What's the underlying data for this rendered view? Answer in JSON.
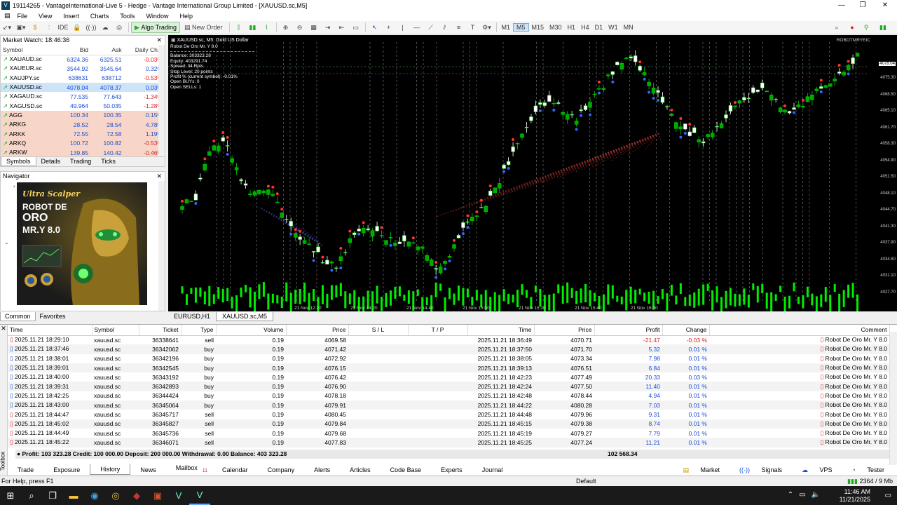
{
  "window": {
    "title": "19114265 - VantageInternational-Live 5 - Hedge - Vantage International Group Limited - [XAUUSD.sc,M5]"
  },
  "menu": [
    "File",
    "View",
    "Insert",
    "Charts",
    "Tools",
    "Window",
    "Help"
  ],
  "toolbar": {
    "algo": "Algo Trading",
    "new_order": "New Order",
    "timeframes": [
      "M1",
      "M5",
      "M15",
      "M30",
      "H1",
      "H4",
      "D1",
      "W1",
      "MN"
    ],
    "active_tf": "M5"
  },
  "market_watch": {
    "title": "Market Watch: 18:46:36",
    "headers": [
      "Symbol",
      "Bid",
      "Ask",
      "Daily Ch..."
    ],
    "rows": [
      [
        "XAUAUD.sc",
        "6324.36",
        "6325.51",
        "-0.03%"
      ],
      [
        "XAUEUR.sc",
        "3544.92",
        "3545.64",
        "0.32%"
      ],
      [
        "XAUJPY.sc",
        "638631",
        "638712",
        "-0.53%"
      ],
      [
        "XAUUSD.sc",
        "4078.04",
        "4078.37",
        "0.03%"
      ],
      [
        "XAGAUD.sc",
        "77.535",
        "77.643",
        "-1.34%"
      ],
      [
        "XAGUSD.sc",
        "49.964",
        "50.035",
        "-1.28%"
      ],
      [
        "AGG",
        "100.34",
        "100.35",
        "0.15%"
      ],
      [
        "ARKG",
        "28.52",
        "28.54",
        "4.78%"
      ],
      [
        "ARKK",
        "72.55",
        "72.58",
        "1.19%"
      ],
      [
        "ARKQ",
        "100.72",
        "100.82",
        "-0.53%"
      ],
      [
        "ARKW",
        "139.85",
        "140.42",
        "-0.46%"
      ]
    ],
    "tabs": [
      "Symbols",
      "Details",
      "Trading",
      "Ticks"
    ]
  },
  "navigator": {
    "title": "Navigator",
    "ad_line1": "Ultra Scalper",
    "ad_line2": "ROBOT DE",
    "ad_line3": "ORO",
    "ad_line4": "MR.Y 8.0",
    "tabs": [
      "Common",
      "Favorites"
    ]
  },
  "chart": {
    "symbol_line": "XAUUSD.sc, M5: Gold US Dollar",
    "ea": "Robot De Oro Mr. Y 8.0",
    "info": [
      "Balance: 303323.28",
      "Equity: 403291.74",
      "Spread: 34 Rpts",
      "Stop Level: 20 points",
      "Profit % (current symbol): -0.01%",
      "Open BUYs: 0",
      "Open SELLs: 1"
    ],
    "corner": "ROBOTMRYEIC",
    "prices": [
      "4075.30",
      "4068.50",
      "4065.10",
      "4061.70",
      "4058.30",
      "4054.90",
      "4051.50",
      "4048.10",
      "4044.70",
      "4041.30",
      "4037.90",
      "4034.50",
      "4031.10",
      "4027.70"
    ],
    "current_price": "4078.04",
    "time_labels": [
      "21 Nov 12:20",
      "21 Nov 14:20",
      "21 Nov 14:40",
      "21 Nov 15:00",
      "21 Nov 15:20",
      "21 Nov 15:40",
      "21 Nov 16:00"
    ],
    "tabs": [
      "EURUSD,H1",
      "XAUUSD.sc,M5"
    ]
  },
  "history": {
    "headers": [
      "Time",
      "Symbol",
      "Ticket",
      "Type",
      "Volume",
      "Price",
      "S / L",
      "T / P",
      "Time",
      "Price",
      "Profit",
      "Change",
      "Comment"
    ],
    "rows": [
      [
        "2025.11.21 18:29:10",
        "xauusd.sc",
        "36338641",
        "sell",
        "0.19",
        "4069.58",
        "",
        "",
        "2025.11.21 18:36:49",
        "4070.71",
        "-21.47",
        "-0.03 %",
        "Robot De Oro Mr. Y 8.0"
      ],
      [
        "2025.11.21 18:37:46",
        "xauusd.sc",
        "36342062",
        "buy",
        "0.19",
        "4071.42",
        "",
        "",
        "2025.11.21 18:37:50",
        "4071.70",
        "5.32",
        "0.01 %",
        "Robot De Oro Mr. Y 8.0"
      ],
      [
        "2025.11.21 18:38:01",
        "xauusd.sc",
        "36342196",
        "buy",
        "0.19",
        "4072.92",
        "",
        "",
        "2025.11.21 18:38:05",
        "4073.34",
        "7.98",
        "0.01 %",
        "Robot De Oro Mr. Y 8.0"
      ],
      [
        "2025.11.21 18:39:01",
        "xauusd.sc",
        "36342545",
        "buy",
        "0.19",
        "4076.15",
        "",
        "",
        "2025.11.21 18:39:13",
        "4076.51",
        "6.84",
        "0.01 %",
        "Robot De Oro Mr. Y 8.0"
      ],
      [
        "2025.11.21 18:40:00",
        "xauusd.sc",
        "36343192",
        "buy",
        "0.19",
        "4076.42",
        "",
        "",
        "2025.11.21 18:42:23",
        "4077.49",
        "20.33",
        "0.03 %",
        "Robot De Oro Mr. Y 8.0"
      ],
      [
        "2025.11.21 18:39:31",
        "xauusd.sc",
        "36342893",
        "buy",
        "0.19",
        "4076.90",
        "",
        "",
        "2025.11.21 18:42:24",
        "4077.50",
        "11.40",
        "0.01 %",
        "Robot De Oro Mr. Y 8.0"
      ],
      [
        "2025.11.21 18:42:25",
        "xauusd.sc",
        "36344424",
        "buy",
        "0.19",
        "4078.18",
        "",
        "",
        "2025.11.21 18:42:48",
        "4078.44",
        "4.94",
        "0.01 %",
        "Robot De Oro Mr. Y 8.0"
      ],
      [
        "2025.11.21 18:43:00",
        "xauusd.sc",
        "36345064",
        "buy",
        "0.19",
        "4079.91",
        "",
        "",
        "2025.11.21 18:44:22",
        "4080.28",
        "7.03",
        "0.01 %",
        "Robot De Oro Mr. Y 8.0"
      ],
      [
        "2025.11.21 18:44:47",
        "xauusd.sc",
        "36345717",
        "sell",
        "0.19",
        "4080.45",
        "",
        "",
        "2025.11.21 18:44:48",
        "4079.96",
        "9.31",
        "0.01 %",
        "Robot De Oro Mr. Y 8.0"
      ],
      [
        "2025.11.21 18:45:02",
        "xauusd.sc",
        "36345827",
        "sell",
        "0.19",
        "4079.84",
        "",
        "",
        "2025.11.21 18:45:15",
        "4079.38",
        "8.74",
        "0.01 %",
        "Robot De Oro Mr. Y 8.0"
      ],
      [
        "2025.11.21 18:44:49",
        "xauusd.sc",
        "36345736",
        "sell",
        "0.19",
        "4079.68",
        "",
        "",
        "2025.11.21 18:45:19",
        "4079.27",
        "7.79",
        "0.01 %",
        "Robot De Oro Mr. Y 8.0"
      ],
      [
        "2025.11.21 18:45:22",
        "xauusd.sc",
        "36346071",
        "sell",
        "0.19",
        "4077.83",
        "",
        "",
        "2025.11.21 18:45:25",
        "4077.24",
        "11.21",
        "0.01 %",
        "Robot De Oro Mr. Y 8.0"
      ]
    ],
    "summary": "Profit: 103 323.28  Credit: 100 000.00  Deposit: 200 000.00  Withdrawal: 0.00  Balance: 403 323.28",
    "total": "102 568.34"
  },
  "bottom_tabs": [
    "Trade",
    "Exposure",
    "History",
    "News",
    "Mailbox",
    "Calendar",
    "Company",
    "Alerts",
    "Articles",
    "Code Base",
    "Experts",
    "Journal"
  ],
  "mailbox_badge": "11",
  "right_tabs": [
    "Market",
    "Signals",
    "VPS",
    "Tester"
  ],
  "toolbox_label": "Toolbox",
  "status": {
    "help": "For Help, press F1",
    "profile": "Default",
    "mem": "2364 / 9 Mb"
  },
  "clock": {
    "time": "11:46 AM",
    "date": "11/21/2025"
  },
  "colors": {
    "chart_bg": "#000000",
    "bull": "#ffffff",
    "bear": "#00c000",
    "volume": "#00e000",
    "negative": "#dd2222",
    "positive": "#1a4fd6"
  }
}
